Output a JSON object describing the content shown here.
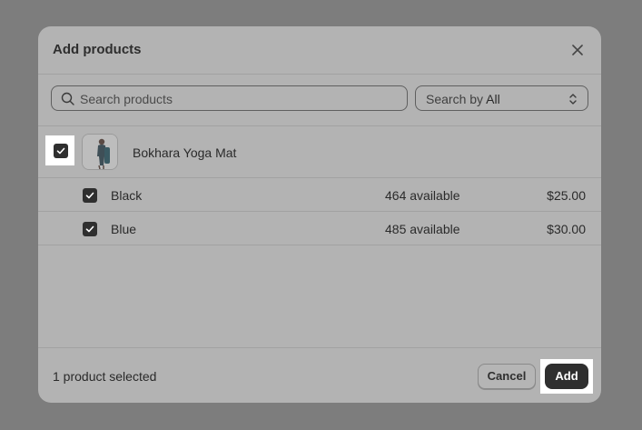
{
  "modal": {
    "title": "Add products"
  },
  "search": {
    "placeholder": "Search products",
    "search_by_label": "Search by",
    "search_by_value": "All"
  },
  "product": {
    "name": "Bokhara Yoga Mat",
    "checked": true,
    "variants": [
      {
        "name": "Black",
        "stock": "464 available",
        "price": "$25.00",
        "checked": true
      },
      {
        "name": "Blue",
        "stock": "485 available",
        "price": "$30.00",
        "checked": true
      }
    ]
  },
  "footer": {
    "status": "1 product selected",
    "cancel_label": "Cancel",
    "add_label": "Add"
  },
  "colors": {
    "overlay": "#7d7d7d",
    "modal_bg": "#b3b3b3",
    "primary_button": "#2f2f2f",
    "highlight": "#ffffff"
  }
}
